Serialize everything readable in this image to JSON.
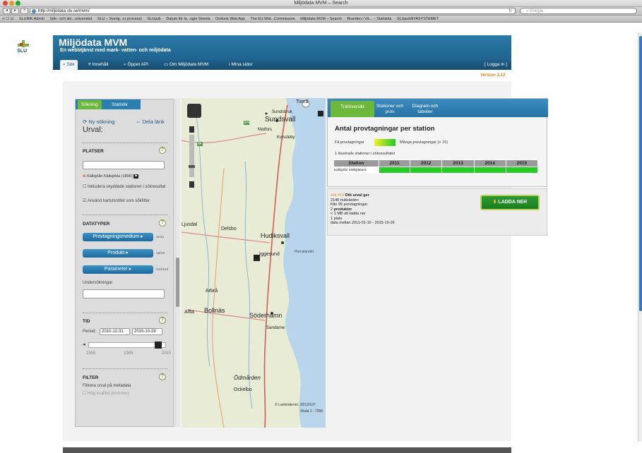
{
  "browser": {
    "window_title": "Miljödata MVM – Search",
    "url": "http://miljodata.slu.se/mvm/",
    "search_placeholder": "Google",
    "bookmarks": [
      "SLUNIK Admin",
      "Sök– och skr...universitet",
      "SLU – Sverig...rs process)",
      "SLUpub",
      "Datum för la...ogle Sheets",
      "Outlook Web App",
      "The EU Wat...Commission",
      "Miljödata MVM – Search",
      "Branden i Vä... – Startsida",
      "SLUpubNYASYSTEMET"
    ]
  },
  "site": {
    "logo_text": "SLU",
    "title": "Miljödata MVM",
    "subtitle": "En webbtjänst med mark- vatten- och miljödata",
    "nav": [
      "Sök",
      "Innehåll",
      "Öppet API",
      "Om Miljödata MVM",
      "Mina sidor"
    ],
    "login": "[ Logga in ]",
    "version": "Version 1.13"
  },
  "left": {
    "tabs": [
      "Sökning",
      "Statistik"
    ],
    "new_search": "Ny sökning",
    "share_link": "Dela länk",
    "selection_title": "Urval:",
    "platser": {
      "title": "PLATSER",
      "selected_station": "Källsjöån Källsjökla (1890)",
      "checkbox_protected": "Inkludera skyddade stationer i sökresultat",
      "checkbox_map": "Använd kartutsnittet som sökfilter"
    },
    "datatyper": {
      "title": "DATATYPER",
      "buttons": [
        {
          "label": "Provtagningsmedium",
          "count": "11/11"
        },
        {
          "label": "Produkt",
          "count": "18/18"
        },
        {
          "label": "Parameter",
          "count": "212/212"
        }
      ],
      "undersokningar_label": "Undersökningar"
    },
    "tid": {
      "title": "TID",
      "period_label": "Period:",
      "from": "2010-12-31",
      "to": "2015-10-29",
      "ticks": [
        "1955",
        "1985",
        "2015"
      ]
    },
    "filter": {
      "title": "FILTER",
      "subtitle": "Filtrera urval på metadata",
      "checkbox_quality": "Hög kvalitet (kommer)"
    }
  },
  "map": {
    "places": [
      "Timrå",
      "Sundsbruk",
      "Sundsvall",
      "Matfors",
      "Kvissleby",
      "Ljusdal",
      "Delsbo",
      "Hudiksvall",
      "Iggesund",
      "Hornslandet",
      "Arbrå",
      "Alfta",
      "Bollnäs",
      "Söderhamn",
      "Sandarne",
      "Ödmården",
      "Ockelbo"
    ],
    "road_labels": [
      "E4",
      "84"
    ],
    "copyright": "© Lantmäteriet, i2012/107",
    "scale": "Skala 1 : 726K"
  },
  "right": {
    "tabs": [
      "Träföversikt",
      "Stationer och prov",
      "Diagram och tabeller"
    ],
    "heading": "Antal provtagningar per station",
    "legend_few": "Få provtagningar",
    "legend_many": "Många provtagningar (> 15)",
    "cluster_note": "1 klustrade stationer i sökresultatet",
    "table_headers": [
      "Station",
      "2011",
      "2012",
      "2013",
      "2014",
      "2015"
    ],
    "table_rows": [
      {
        "station": "Källsjöån Källsjöklack",
        "filled": [
          true,
          true,
          true,
          true,
          true
        ]
      }
    ],
    "colors": {
      "filled": "#22cc22",
      "legend_low": "#f2ef2a",
      "legend_high": "#22cc22"
    }
  },
  "summary": {
    "prefix": "sök #13",
    "title": "Ditt urval ger",
    "lines": [
      "2148 mätvärden",
      "från 95 provtagningar"
    ],
    "products_count": "2",
    "products_label": "produkter",
    "size": "< 1 MB att ladda ner",
    "places": "1 plats",
    "date_range": "data mellan 2011-01-10 - 2015-10-26",
    "download": "LADDA NER"
  }
}
